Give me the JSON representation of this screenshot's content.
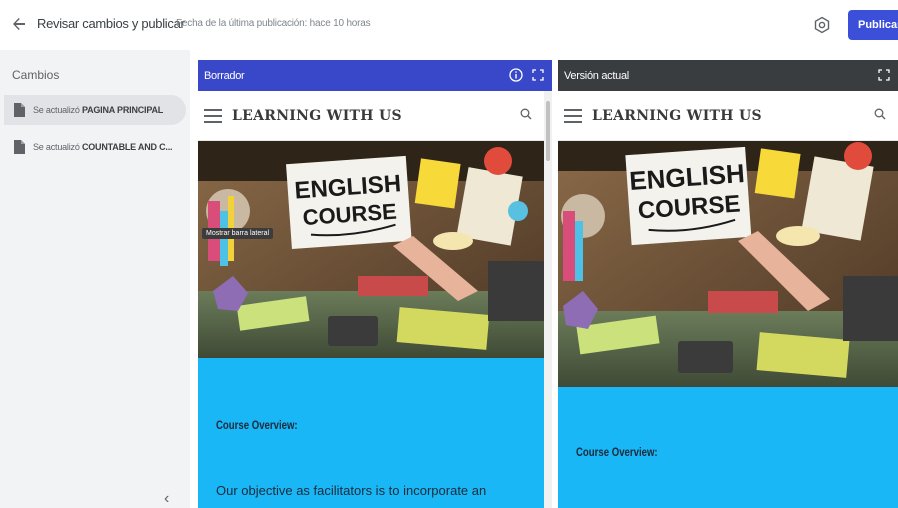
{
  "topbar": {
    "title": "Revisar cambios y publicar",
    "last_published": "Fecha de la última publicación: hace 10 horas",
    "publish_label": "Publicar"
  },
  "sidebar": {
    "title": "Cambios",
    "items": [
      {
        "prefix": "Se actualizó ",
        "page": "PAGINA PRINCIPAL"
      },
      {
        "prefix": "Se actualizó ",
        "page": "COUNTABLE AND C..."
      }
    ]
  },
  "draft": {
    "header": "Borrador",
    "site_title": "LEARNING WITH US",
    "tooltip": "Mostrar barra lateral",
    "poster_line1": "ENGLISH",
    "poster_line2": "COURSE",
    "overview": "Course Overview:",
    "body_text": "Our objective as facilitators is to incorporate an"
  },
  "current": {
    "header": "Versión actual",
    "site_title": "LEARNING WITH US",
    "poster_line1": "ENGLISH",
    "poster_line2": "COURSE",
    "overview": "Course Overview:"
  },
  "colors": {
    "publish": "#3b4fd8",
    "draft_header": "#3948c9",
    "current_header": "#3a3d40",
    "section_blue": "#19b7f5"
  }
}
